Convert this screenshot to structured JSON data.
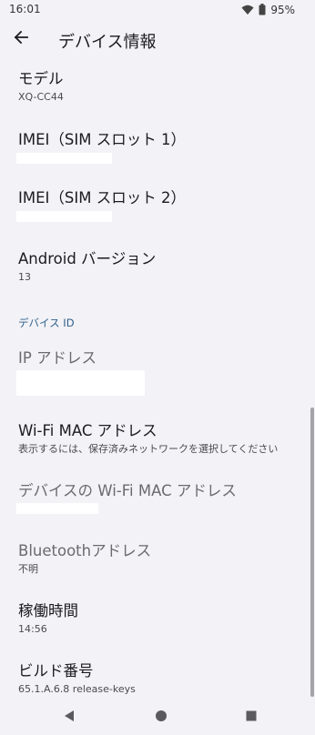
{
  "status_bar": {
    "time": "16:01",
    "battery": "95%",
    "wifi_icon": "wifi-icon",
    "battery_icon": "battery-icon"
  },
  "app_bar": {
    "title": "デバイス情報",
    "back_icon": "arrow-back-icon"
  },
  "items": {
    "model": {
      "title": "モデル",
      "value": "XQ-CC44"
    },
    "imei1": {
      "title": "IMEI（SIM スロット 1）"
    },
    "imei2": {
      "title": "IMEI（SIM スロット 2）"
    },
    "android_version": {
      "title": "Android バージョン",
      "value": "13"
    },
    "section_device_id": "デバイス ID",
    "ip_address": {
      "title": "IP アドレス"
    },
    "wifi_mac": {
      "title": "Wi-Fi MAC アドレス",
      "value": "表示するには、保存済みネットワークを選択してください"
    },
    "device_wifi_mac": {
      "title": "デバイスの Wi-Fi MAC アドレス"
    },
    "bluetooth": {
      "title": "Bluetoothアドレス",
      "value": "不明"
    },
    "uptime": {
      "title": "稼働時間",
      "value": "14:56"
    },
    "build_number": {
      "title": "ビルド番号",
      "value": "65.1.A.6.8 release-keys"
    }
  },
  "nav_bar": {
    "back": "nav-back-icon",
    "home": "nav-home-icon",
    "recents": "nav-recents-icon"
  },
  "colors": {
    "background": "#f3f2f7",
    "section_header": "#2c5f8a",
    "text_primary": "#1c1b1f",
    "text_disabled": "#6a6a70"
  }
}
